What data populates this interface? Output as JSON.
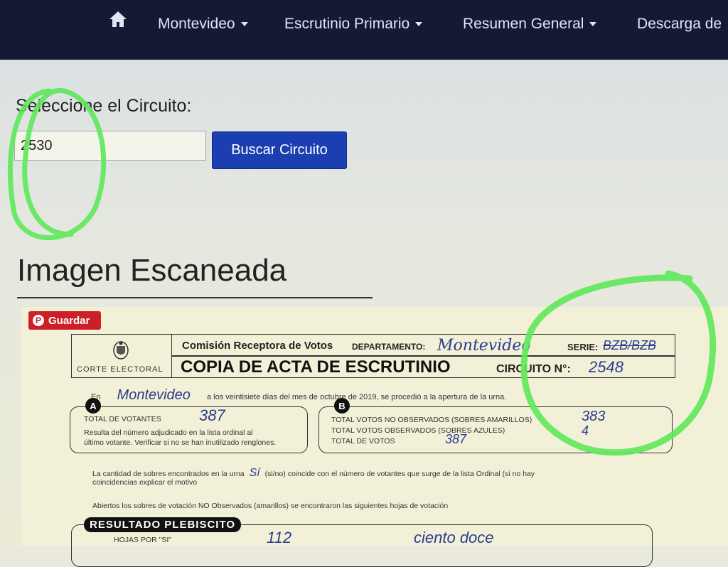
{
  "nav": {
    "items": [
      {
        "label": "Montevideo"
      },
      {
        "label": "Escrutinio Primario"
      },
      {
        "label": "Resumen General"
      },
      {
        "label": "Descarga de"
      }
    ]
  },
  "search": {
    "label": "Seleccione el Circuito:",
    "input_value": "2530",
    "button_label": "Buscar Circuito"
  },
  "scanned": {
    "section_title": "Imagen Escaneada",
    "save_label": "Guardar",
    "save_glyph": "P",
    "seal_label": "CORTE ELECTORAL",
    "comision": "Comisión Receptora de Votos",
    "departamento_label": "DEPARTAMENTO:",
    "departamento_value": "Montevideo",
    "serie_label": "SERIE:",
    "serie_value": "BZB/BZB",
    "acta_title": "COPIA DE ACTA DE ESCRUTINIO",
    "circuito_label": "CIRCUITO N°:",
    "circuito_value": "2548",
    "en_prefix": "En",
    "en_hand": "Montevideo",
    "en_suffix": "a los veintisiete días del mes de octubre de 2019, se procedió a la apertura de la urna.",
    "box_a": {
      "badge": "A",
      "label": "TOTAL DE VOTANTES",
      "value": "387",
      "note1": "Resulta del número adjudicado en la lista ordinal al",
      "note2": "último votante. Verificar si no se han inutilizado renglones."
    },
    "box_b": {
      "badge": "B",
      "line1": "TOTAL VOTOS NO OBSERVADOS (SOBRES AMARILLOS)",
      "line2": "TOTAL VOTOS OBSERVADOS (SOBRES AZULES)",
      "line3": "TOTAL DE VOTOS",
      "value1": "383",
      "value2": "4",
      "value3": "387"
    },
    "cantidad_line1": "La cantidad de sobres encontrados en la urna",
    "cantidad_hand": "Sí",
    "cantidad_line1b": "(si/no) coincide con el número de votantes que surge de la lista Ordinal (si no hay",
    "cantidad_line2": "coincidencias explicar el motivo",
    "abiertos_line": "Abiertos los sobres de votación NO Observados (amarillos) se encontraron las siguientes hojas de votación",
    "result_title": "RESULTADO PLEBISCITO",
    "hojas_label": "HOJAS POR \"SI\"",
    "hojas_value": "112",
    "hojas_words": "ciento doce"
  },
  "colors": {
    "navbar": "#141a33",
    "primary_button": "#1b3fb0",
    "save_button": "#cb2027",
    "annotation": "#5ee85a"
  }
}
